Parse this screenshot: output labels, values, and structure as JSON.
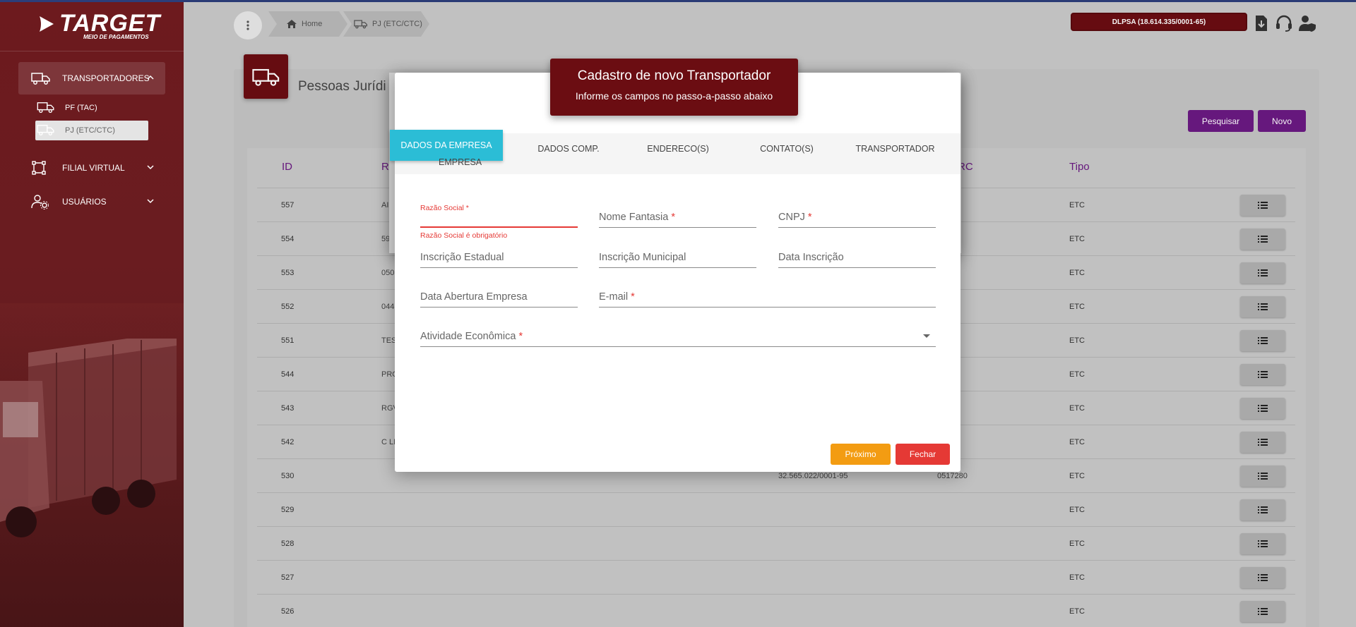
{
  "brand": {
    "name": "TARGET",
    "tagline": "MEIO DE PAGAMENTOS"
  },
  "sidebar": {
    "items": [
      {
        "label": "TRANSPORTADORES",
        "icon": "truck-icon"
      },
      {
        "label": "FILIAL VIRTUAL",
        "icon": "nodes-icon"
      },
      {
        "label": "USUÁRIOS",
        "icon": "users-gear-icon"
      }
    ],
    "subitems": [
      {
        "label": "PF (TAC)",
        "icon": "truck-icon"
      },
      {
        "label": "PJ (ETC/CTC)",
        "icon": "truck-icon"
      }
    ]
  },
  "header": {
    "breadcrumb": [
      {
        "label": "Home",
        "icon": "home-icon"
      },
      {
        "label": "PJ (ETC/CTC)",
        "icon": "truck-icon"
      }
    ],
    "company": "DLPSA (18.614.335/0001-65)",
    "icons": [
      "download-icon",
      "headset-icon",
      "user-shield-icon"
    ]
  },
  "page": {
    "title": "Pessoas Jurídi",
    "search_label": "Pesquisar",
    "new_label": "Novo"
  },
  "table": {
    "headers": {
      "id": "ID",
      "razao": "R",
      "rntrc": "RC",
      "tipo": "Tipo"
    },
    "rows": [
      {
        "id": "557",
        "razao": "AI",
        "cnpj": "",
        "rntrc": "",
        "tipo": "ETC"
      },
      {
        "id": "554",
        "razao": "59",
        "cnpj": "",
        "rntrc": "",
        "tipo": "ETC"
      },
      {
        "id": "553",
        "razao": "050",
        "cnpj": "",
        "rntrc": "",
        "tipo": "ETC"
      },
      {
        "id": "552",
        "razao": "044",
        "cnpj": "",
        "rntrc": "",
        "tipo": "ETC"
      },
      {
        "id": "551",
        "razao": "TES",
        "cnpj": "",
        "rntrc": "",
        "tipo": "ETC"
      },
      {
        "id": "544",
        "razao": "PRO",
        "cnpj": "",
        "rntrc": "",
        "tipo": "ETC"
      },
      {
        "id": "543",
        "razao": "RGV",
        "cnpj": "",
        "rntrc": "",
        "tipo": "ETC"
      },
      {
        "id": "542",
        "razao": "C LI",
        "cnpj": "",
        "rntrc": "",
        "tipo": "ETC"
      },
      {
        "id": "530",
        "razao": "",
        "cnpj": "32.565.022/0001-95",
        "rntrc": "0517280",
        "tipo": "ETC"
      },
      {
        "id": "529",
        "razao": "",
        "cnpj": "",
        "rntrc": "",
        "tipo": "ETC"
      },
      {
        "id": "528",
        "razao": "",
        "cnpj": "",
        "rntrc": "",
        "tipo": "ETC"
      },
      {
        "id": "527",
        "razao": "",
        "cnpj": "",
        "rntrc": "",
        "tipo": "ETC"
      },
      {
        "id": "526",
        "razao": "",
        "cnpj": "",
        "rntrc": "",
        "tipo": "ETC"
      }
    ]
  },
  "modal": {
    "title": "Cadastro de novo Transportador",
    "subtitle": "Informe os campos no passo-a-passo abaixo",
    "tabs": [
      "DADOS DA EMPRESA",
      "DADOS COMP.",
      "ENDERECO(S)",
      "CONTATO(S)",
      "TRANSPORTADOR"
    ],
    "tab_overflow": "EMPRESA",
    "fields": {
      "razao_social": "Razão Social",
      "razao_social_error": "Razão Social é obrigatório",
      "nome_fantasia": "Nome Fantasia",
      "cnpj": "CNPJ",
      "inscricao_estadual": "Inscrição Estadual",
      "inscricao_municipal": "Inscrição Municipal",
      "data_inscricao": "Data Inscrição",
      "data_abertura": "Data Abertura Empresa",
      "email": "E-mail",
      "atividade": "Atividade Econômica",
      "required_mark": "*"
    },
    "next_label": "Próximo",
    "close_label": "Fechar"
  },
  "colors": {
    "brand": "#6b0d12",
    "accent_purple": "#6b1a83",
    "tab_active": "#2bbdd6",
    "error": "#e53935",
    "next": "#f39c12"
  }
}
